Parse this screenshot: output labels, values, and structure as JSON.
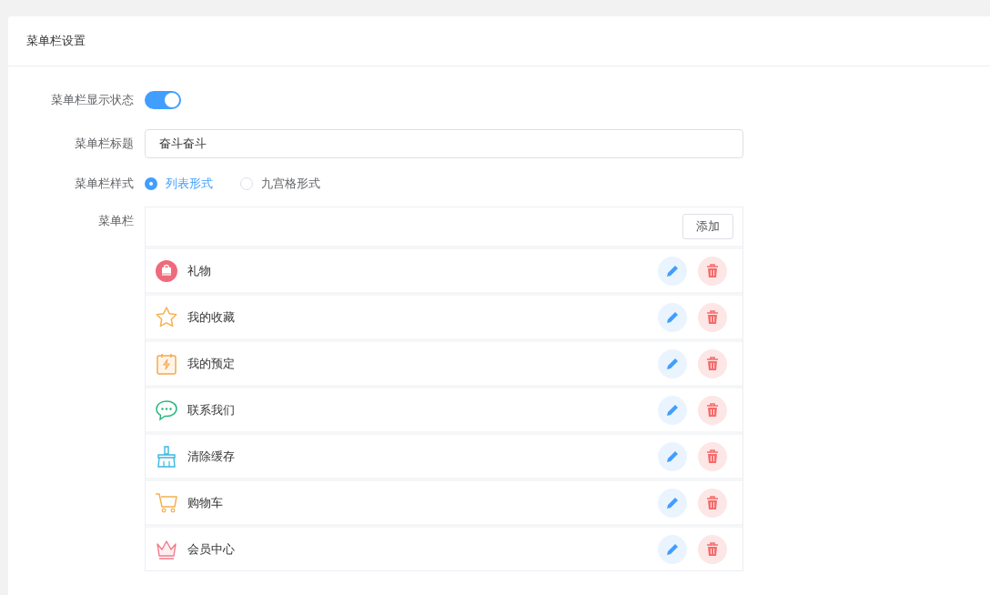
{
  "card_title": "菜单栏设置",
  "fields": {
    "show_label": "菜单栏显示状态",
    "show_on": true,
    "title_label": "菜单栏标题",
    "title_value": "奋斗奋斗",
    "style_label": "菜单栏样式",
    "style_options": [
      {
        "label": "列表形式",
        "selected": true
      },
      {
        "label": "九宫格形式",
        "selected": false
      }
    ],
    "menu_label": "菜单栏",
    "add_button": "添加"
  },
  "menu_items": [
    {
      "kind": "gift",
      "label": "礼物"
    },
    {
      "kind": "star",
      "label": "我的收藏"
    },
    {
      "kind": "calendar",
      "label": "我的预定"
    },
    {
      "kind": "chat",
      "label": "联系我们"
    },
    {
      "kind": "broom",
      "label": "清除缓存"
    },
    {
      "kind": "cart",
      "label": "购物车"
    },
    {
      "kind": "crown",
      "label": "会员中心"
    }
  ]
}
